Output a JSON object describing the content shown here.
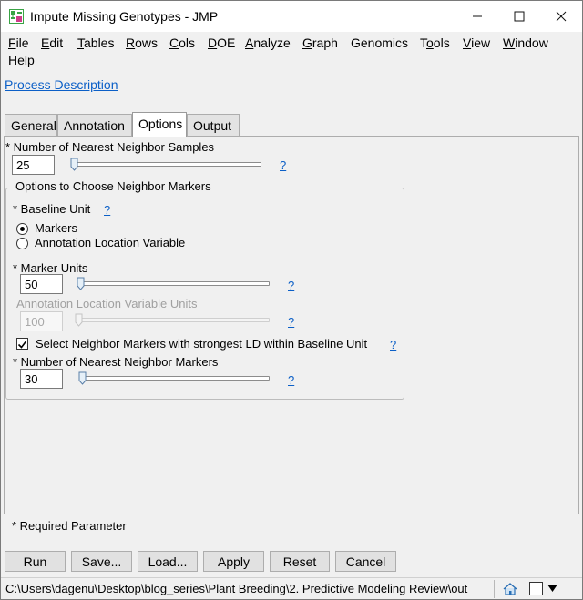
{
  "window": {
    "title": "Impute Missing Genotypes - JMP"
  },
  "menu": [
    {
      "pre": "",
      "u": "F",
      "post": "ile"
    },
    {
      "pre": "",
      "u": "E",
      "post": "dit"
    },
    {
      "pre": "",
      "u": "T",
      "post": "ables"
    },
    {
      "pre": "",
      "u": "R",
      "post": "ows"
    },
    {
      "pre": "",
      "u": "C",
      "post": "ols"
    },
    {
      "pre": "",
      "u": "D",
      "post": "OE"
    },
    {
      "pre": "",
      "u": "A",
      "post": "nalyze"
    },
    {
      "pre": "",
      "u": "G",
      "post": "raph"
    },
    {
      "pre": "Genomics",
      "u": "",
      "post": ""
    },
    {
      "pre": "T",
      "u": "o",
      "post": "ols"
    },
    {
      "pre": "",
      "u": "V",
      "post": "iew"
    },
    {
      "pre": "",
      "u": "W",
      "post": "indow"
    },
    {
      "pre": "",
      "u": "H",
      "post": "elp"
    }
  ],
  "process_description": "Process Description",
  "tabs": [
    "General",
    "Annotation",
    "Options",
    "Output"
  ],
  "options": {
    "nn_samples_label": "* Number of Nearest Neighbor Samples",
    "nn_samples_value": "25",
    "group_title": "Options to Choose Neighbor Markers",
    "baseline_unit_label": "* Baseline Unit",
    "radio_markers": "Markers",
    "radio_annotation": "Annotation Location Variable",
    "marker_units_label": "* Marker Units",
    "marker_units_value": "50",
    "annotation_units_label": "Annotation Location Variable Units",
    "annotation_units_value": "100",
    "strongest_ld_label": "Select Neighbor Markers with strongest LD within Baseline Unit",
    "nn_markers_label": "* Number of Nearest Neighbor Markers",
    "nn_markers_value": "30",
    "help": "?"
  },
  "required_note": "* Required Parameter",
  "buttons": {
    "run": "Run",
    "save": "Save...",
    "load": "Load...",
    "apply": "Apply",
    "reset": "Reset",
    "cancel": "Cancel"
  },
  "status": {
    "path": "C:\\Users\\dagenu\\Desktop\\blog_series\\Plant Breeding\\2. Predictive Modeling Review\\out"
  },
  "icons": {
    "app": "jmp-app-icon",
    "minimize": "minimize-icon",
    "maximize": "maximize-icon",
    "close": "close-icon",
    "home": "home-icon",
    "window": "window-icon",
    "dropdown": "triangle-down-icon"
  },
  "colors": {
    "link": "#0b5fc7",
    "accent_green": "#3aa345"
  }
}
